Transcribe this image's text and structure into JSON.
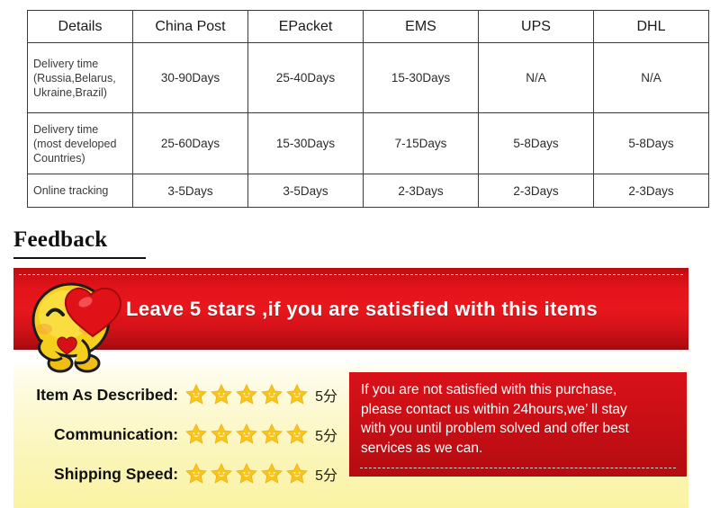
{
  "shipping_table": {
    "headers": [
      "Details",
      "China Post",
      "EPacket",
      "EMS",
      "UPS",
      "DHL"
    ],
    "rows": [
      {
        "label": "Delivery time (Russia,Belarus, Ukraine,Brazil)",
        "label_lines": [
          "Delivery time",
          "(Russia,Belarus,",
          "Ukraine,Brazil)"
        ],
        "values": [
          "30-90Days",
          "25-40Days",
          "15-30Days",
          "N/A",
          "N/A"
        ]
      },
      {
        "label": "Delivery time (most developed Countries)",
        "label_lines": [
          "Delivery time",
          "(most developed",
          "Countries)"
        ],
        "values": [
          "25-60Days",
          "15-30Days",
          "7-15Days",
          "5-8Days",
          "5-8Days"
        ]
      },
      {
        "label": "Online tracking",
        "label_lines": [
          "Online tracking"
        ],
        "values": [
          "3-5Days",
          "3-5Days",
          "2-3Days",
          "2-3Days",
          "2-3Days"
        ]
      }
    ]
  },
  "feedback": {
    "heading": "Feedback",
    "banner": {
      "text": "Leave 5 stars ,if you are satisfied with this items",
      "bg_color": "#e3141a",
      "mascot": "kissing-chick-with-heart"
    },
    "ratings": [
      {
        "label": "Item As Described:",
        "stars": 5,
        "score": "5分"
      },
      {
        "label": "Communication:",
        "stars": 5,
        "score": "5分"
      },
      {
        "label": "Shipping Speed:",
        "stars": 5,
        "score": "5分"
      }
    ],
    "note": {
      "line1": "If you are not satisfied with this purchase,",
      "line2": "please contact us within 24hours,we’ ll stay",
      "line3": "with you until problem solved and offer best",
      "line4": "services as we can.",
      "bg_color": "#c20e14"
    },
    "star_color": "#f8c51c",
    "panel_bg_top": "#fffef3",
    "panel_bg_bottom": "#f9f3a3"
  }
}
